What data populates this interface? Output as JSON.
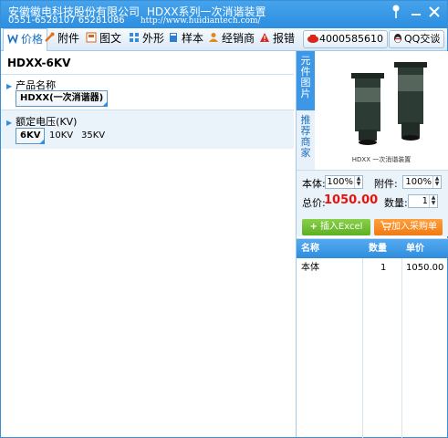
{
  "window": {
    "title_company": "安徽徽电科技股份有限公司",
    "title_product": "HDXX系列一次消谐装置",
    "phones": "0551-6528107  65281086",
    "url": "http://www.huidiantech.com/",
    "pin_icon": "pin-icon",
    "min_icon": "minimize-icon",
    "close_icon": "close-icon"
  },
  "toolbar": {
    "tabs": [
      {
        "label": "价格",
        "icon": "price-tag-icon"
      },
      {
        "label": "附件",
        "icon": "tools-icon"
      },
      {
        "label": "图文",
        "icon": "document-image-icon"
      },
      {
        "label": "外形",
        "icon": "grid-shape-icon"
      },
      {
        "label": "样本",
        "icon": "book-icon"
      },
      {
        "label": "经销商",
        "icon": "user-icon"
      },
      {
        "label": "报错",
        "icon": "warning-icon"
      }
    ],
    "phone": "4000585610",
    "qq": "QQ交谈"
  },
  "product": {
    "title": "HDXX-6KV",
    "name_label": "产品名称",
    "name_options": [
      "HDXX(一次消谐器)"
    ],
    "voltage_label": "额定电压(KV)",
    "voltage_options": [
      "6KV",
      "10KV",
      "35KV"
    ],
    "voltage_selected": "6KV"
  },
  "side_tabs": {
    "components": "元件图片",
    "dealers": "推荐商家"
  },
  "image_caption": "HDXX 一次消谐装置",
  "form": {
    "body_label": "本体:",
    "body_value": "100%",
    "accessory_label": "附件:",
    "accessory_value": "100%",
    "total_label": "总价:",
    "total_value": "1050.00",
    "qty_label": "数量:",
    "qty_value": "1",
    "excel_button": "插入Excel",
    "cart_button": "加入采购单",
    "price_color": "#e8140c"
  },
  "cart_table": {
    "headers": [
      "名称",
      "数量",
      "单价"
    ],
    "rows": [
      [
        "本体",
        "1",
        "1050.00"
      ]
    ]
  }
}
